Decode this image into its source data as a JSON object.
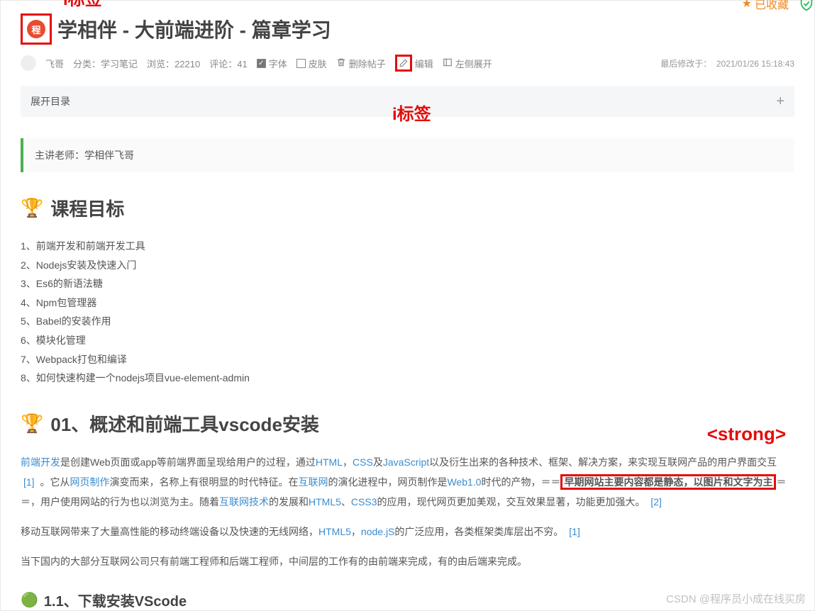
{
  "annotations": {
    "i_tag_top": "i标签",
    "i_tag_mid": "i标签",
    "strong_tag": "<strong>"
  },
  "header": {
    "icon_char": "程",
    "title": "学相伴 - 大前端进阶 - 篇章学习",
    "favorited_label": "已收藏"
  },
  "meta": {
    "author": "飞哥",
    "category_label": "分类：",
    "category_value": "学习笔记",
    "views_label": "浏览：",
    "views_value": "22210",
    "comments_label": "评论：",
    "comments_value": "41",
    "font_label": "字体",
    "skin_label": "皮肤",
    "delete_label": "删除帖子",
    "edit_label": "编辑",
    "expand_left_label": "左侧展开",
    "last_modified_label": "最后修改于：",
    "last_modified_value": "2021/01/26 15:18:43"
  },
  "toc": {
    "expand_label": "展开目录"
  },
  "quote": {
    "text": "主讲老师：学相伴飞哥"
  },
  "sections": {
    "goal_title": "课程目标",
    "goal_items": [
      "1、前端开发和前端开发工具",
      "2、Nodejs安装及快速入门",
      "3、Es6的新语法糖",
      "4、Npm包管理器",
      "5、Babel的安装作用",
      "6、模块化管理",
      "7、Webpack打包和编译",
      "8、如何快速构建一个nodejs项目vue-element-admin"
    ],
    "sec01_title": "01、概述和前端工具vscode安装",
    "p1": {
      "l1": "前端开发",
      "t1": "是创建Web页面或app等前端界面呈现给用户的过程，通过",
      "l2": "HTML",
      "sep": "，",
      "l3": "CSS",
      "t2": "及",
      "l4": "JavaScript",
      "t3": "以及衍生出来的各种技术、框架、解决方案，来实现互联网产品的用户界面交互 ",
      "r1": "[1]",
      "t4": " 。它从",
      "l5": "网页制作",
      "t5": "演变而来，名称上有很明显的时代特征。在",
      "l6": "互联网",
      "t6": "的演化进程中，网页制作是",
      "l7": "Web1.0",
      "t7": "时代的产物，＝＝",
      "strong": "早期网站主要内容都是静态，以图片和文字为主",
      "t8": "＝＝，用户使用网站的行为也以浏览为主。随着",
      "l8": "互联网技术",
      "t9": "的发展和",
      "l9": "HTML5",
      "t10": "、",
      "l10": "CSS3",
      "t11": "的应用，现代网页更加美观，交互效果显著，功能更加强大。 ",
      "r2": "[2]"
    },
    "p2": {
      "t1": "移动互联网带来了大量高性能的移动终端设备以及快速的无线网络，",
      "l1": "HTML5",
      "sep": "，",
      "l2": "node.jS",
      "t2": "的广泛应用，各类框架类库层出不穷。 ",
      "r1": "[1]"
    },
    "p3": "当下国内的大部分互联网公司只有前端工程师和后端工程师，中间层的工作有的由前端来完成，有的由后端来完成。",
    "sub11_title": "1.1、下载安装VScode"
  },
  "watermark": "CSDN @程序员小成在线买房"
}
